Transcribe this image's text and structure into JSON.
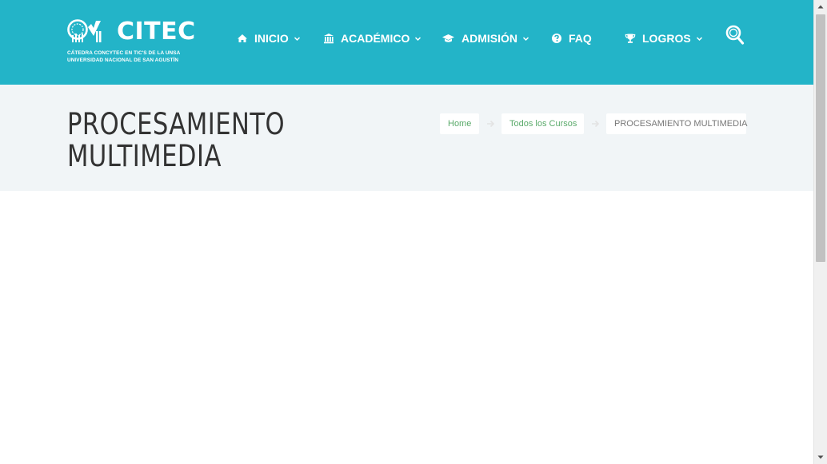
{
  "theme": {
    "brand": "#23b4c8",
    "title_band": "#f1f5f7",
    "crumb_link": "#5aaa6a"
  },
  "logo": {
    "name": "CITEC",
    "line1": "CÁTEDRA CONCYTEC EN TIC'S DE LA UNSA",
    "line2": "UNIVERSIDAD NACIONAL DE SAN AGUSTÍN"
  },
  "nav": {
    "items": [
      {
        "label": "INICIO",
        "icon": "home-icon",
        "dropdown": true
      },
      {
        "label": "ACADÉMICO",
        "icon": "university-icon",
        "dropdown": true
      },
      {
        "label": "ADMISIÓN",
        "icon": "graduation-cap-icon",
        "dropdown": true
      },
      {
        "label": "FAQ",
        "icon": "question-circle-icon",
        "dropdown": false
      },
      {
        "label": "LOGROS",
        "icon": "trophy-icon",
        "dropdown": true
      }
    ],
    "search_icon": "search-icon"
  },
  "page": {
    "title_line1": "PROCESAMIENTO",
    "title_line2": "MULTIMEDIA"
  },
  "breadcrumb": {
    "items": [
      "Home",
      "Todos los Cursos",
      "PROCESAMIENTO MULTIMEDIA"
    ],
    "separator_icon": "arrow-right-icon"
  }
}
